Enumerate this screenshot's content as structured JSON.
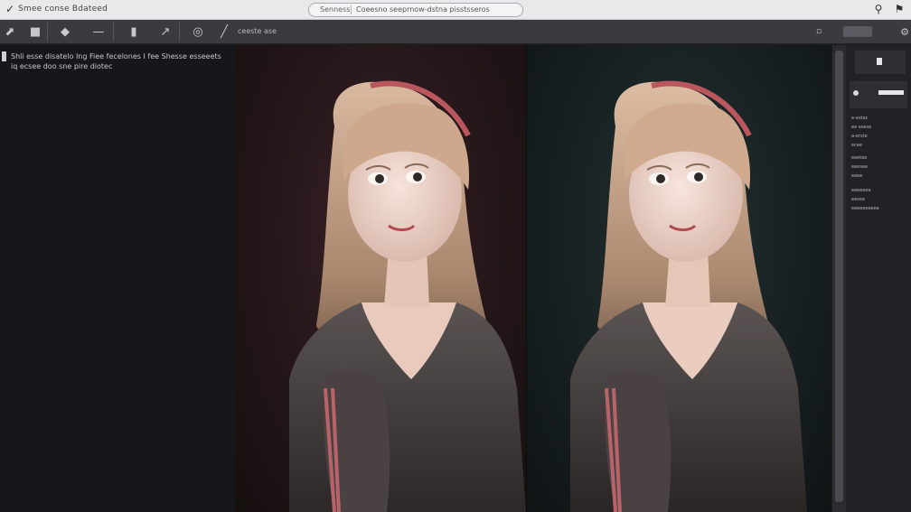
{
  "window": {
    "title": "Smee conse Bdateed",
    "address_label": "Senness",
    "address_url": "Coeesno seeprnow-dstna pisstsseros"
  },
  "toolbar": {
    "zoom_text": "ceeste ase"
  },
  "left_panel": {
    "lines": [
      "Shli esse disatelo Ing Fiee fecelones I fee Shesse esseeets",
      "iq ecsee doo sne pire diotec"
    ]
  },
  "side_panel": {
    "rows": [
      "e-estac",
      "ee esese",
      "a-erste",
      "ecee",
      "eeetee",
      "eeesee",
      "eeee",
      "eeeeeee",
      "eesee",
      "eeeeeeeeee"
    ]
  },
  "icons": [
    "arrow-icon",
    "square-icon",
    "eraser-icon",
    "line-icon",
    "pen-icon",
    "pick-icon",
    "circle-icon",
    "slash-icon",
    "lock-icon",
    "layout-icon",
    "gear-icon",
    "pin-icon",
    "flag-icon"
  ]
}
